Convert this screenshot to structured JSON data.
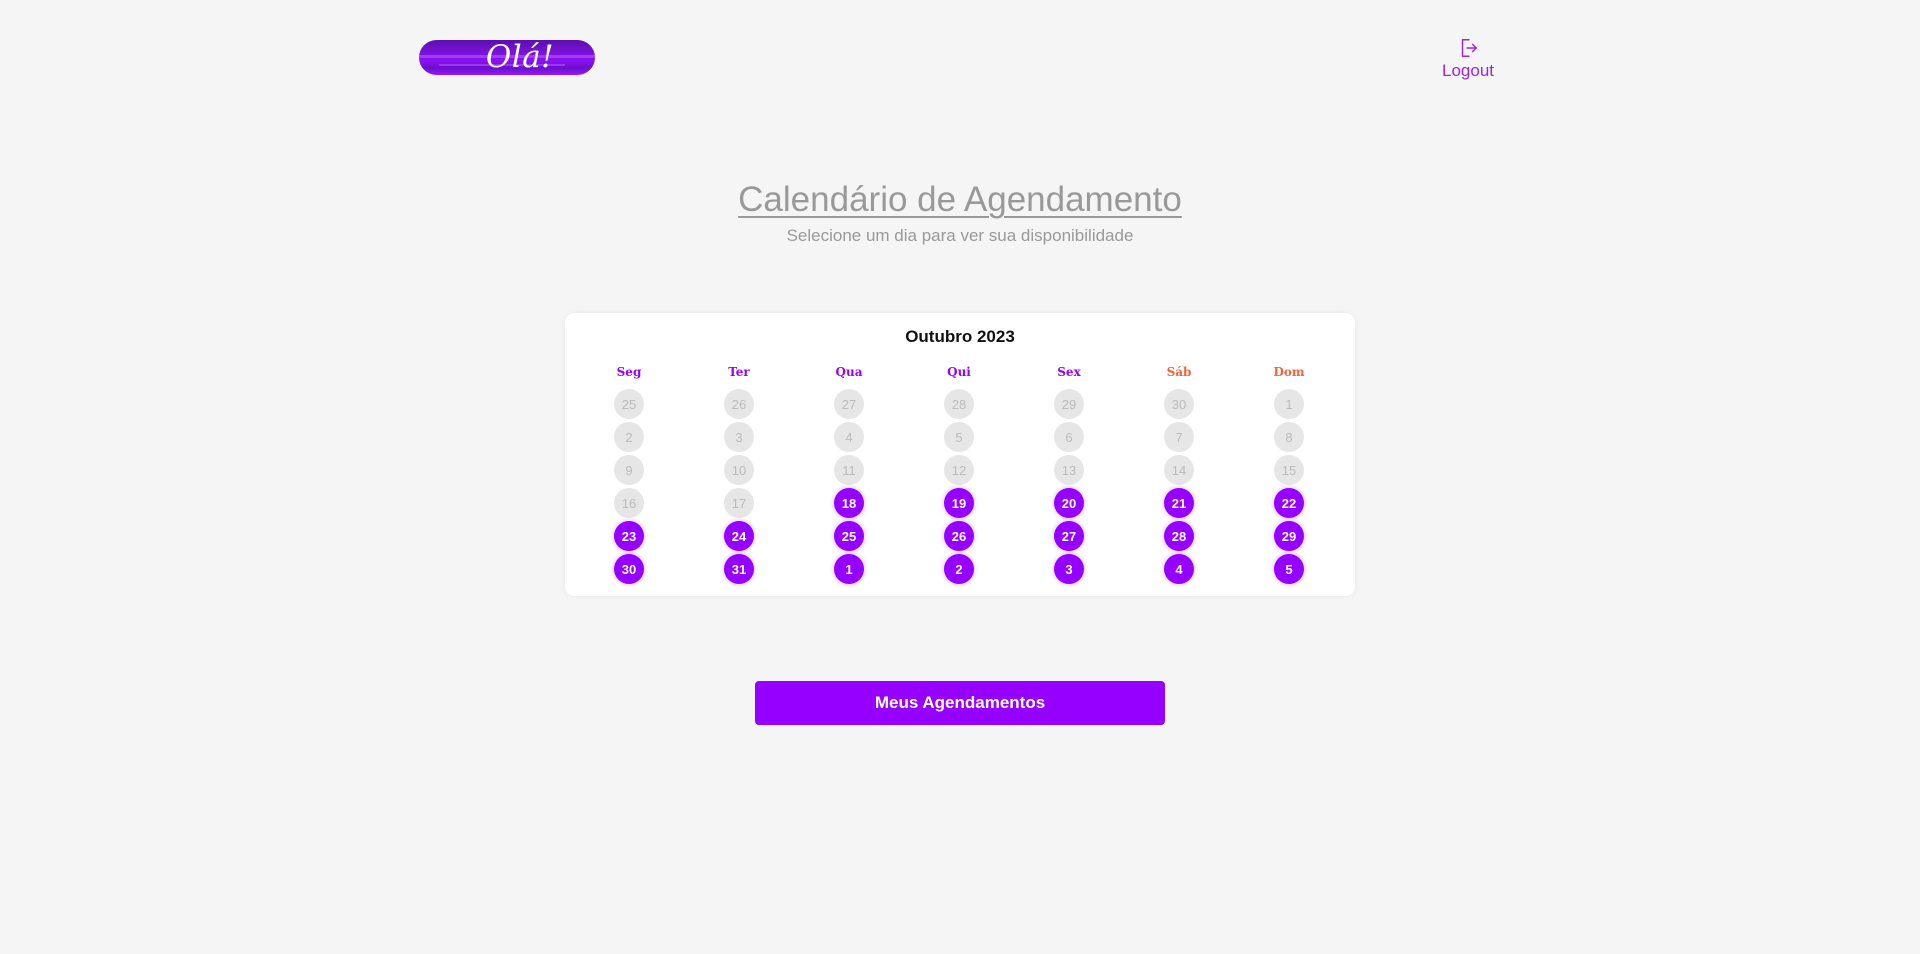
{
  "header": {
    "logo_text": "Olá!",
    "logout_label": "Logout",
    "logout_icon": "logout-icon"
  },
  "page": {
    "title": "Calendário de Agendamento",
    "subtitle": "Selecione um dia para ver sua disponibilidade"
  },
  "calendar": {
    "month_label": "Outubro 2023",
    "weekdays": [
      {
        "label": "Seg",
        "color": "#9500ff"
      },
      {
        "label": "Ter",
        "color": "#9500ff"
      },
      {
        "label": "Qua",
        "color": "#9500ff"
      },
      {
        "label": "Qui",
        "color": "#9500ff"
      },
      {
        "label": "Sex",
        "color": "#9500ff"
      },
      {
        "label": "Sáb",
        "color": "#f0643c"
      },
      {
        "label": "Dom",
        "color": "#f0643c"
      }
    ],
    "weeks": [
      [
        {
          "d": "25",
          "a": false
        },
        {
          "d": "26",
          "a": false
        },
        {
          "d": "27",
          "a": false
        },
        {
          "d": "28",
          "a": false
        },
        {
          "d": "29",
          "a": false
        },
        {
          "d": "30",
          "a": false
        },
        {
          "d": "1",
          "a": false
        }
      ],
      [
        {
          "d": "2",
          "a": false
        },
        {
          "d": "3",
          "a": false
        },
        {
          "d": "4",
          "a": false
        },
        {
          "d": "5",
          "a": false
        },
        {
          "d": "6",
          "a": false
        },
        {
          "d": "7",
          "a": false
        },
        {
          "d": "8",
          "a": false
        }
      ],
      [
        {
          "d": "9",
          "a": false
        },
        {
          "d": "10",
          "a": false
        },
        {
          "d": "11",
          "a": false
        },
        {
          "d": "12",
          "a": false
        },
        {
          "d": "13",
          "a": false
        },
        {
          "d": "14",
          "a": false
        },
        {
          "d": "15",
          "a": false
        }
      ],
      [
        {
          "d": "16",
          "a": false
        },
        {
          "d": "17",
          "a": false
        },
        {
          "d": "18",
          "a": true
        },
        {
          "d": "19",
          "a": true
        },
        {
          "d": "20",
          "a": true
        },
        {
          "d": "21",
          "a": true
        },
        {
          "d": "22",
          "a": true
        }
      ],
      [
        {
          "d": "23",
          "a": true
        },
        {
          "d": "24",
          "a": true
        },
        {
          "d": "25",
          "a": true
        },
        {
          "d": "26",
          "a": true
        },
        {
          "d": "27",
          "a": true
        },
        {
          "d": "28",
          "a": true
        },
        {
          "d": "29",
          "a": true
        }
      ],
      [
        {
          "d": "30",
          "a": true
        },
        {
          "d": "31",
          "a": true
        },
        {
          "d": "1",
          "a": true
        },
        {
          "d": "2",
          "a": true
        },
        {
          "d": "3",
          "a": true
        },
        {
          "d": "4",
          "a": true
        },
        {
          "d": "5",
          "a": true
        }
      ]
    ]
  },
  "actions": {
    "my_appointments_label": "Meus Agendamentos"
  },
  "colors": {
    "accent": "#9500ff",
    "weekend": "#f0643c",
    "disabled_day_bg": "#e6e6e6",
    "background": "#f5f5f5"
  }
}
